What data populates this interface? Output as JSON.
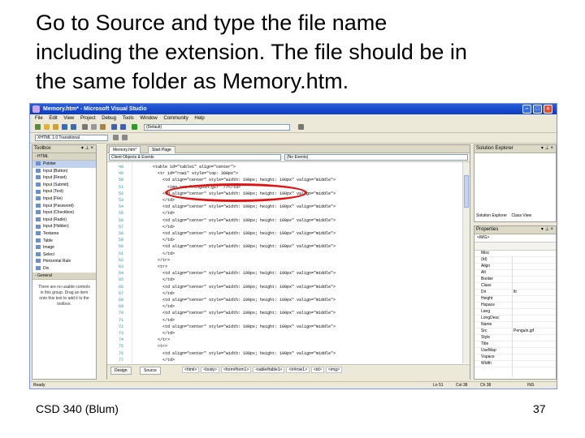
{
  "slide": {
    "title": "Go to Source and type the file name\nincluding the extension. The file should be in\nthe same folder as Memory.htm.",
    "footer_left": "CSD 340 (Blum)",
    "page_number": "37"
  },
  "window": {
    "title": "Memory.htm* - Microsoft Visual Studio",
    "menu": [
      "File",
      "Edit",
      "View",
      "Project",
      "Debug",
      "Tools",
      "Window",
      "Community",
      "Help"
    ],
    "toolbar_combo": "(Default)",
    "toolbar2_combo": "XHTML 1.0 Transitional"
  },
  "toolbox": {
    "title": "Toolbox",
    "section_html": "- HTML",
    "items": [
      "Pointer",
      "Input (Button)",
      "Input (Reset)",
      "Input (Submit)",
      "Input (Text)",
      "Input (File)",
      "Input (Password)",
      "Input (Checkbox)",
      "Input (Radio)",
      "Input (Hidden)",
      "Textarea",
      "Table",
      "Image",
      "Select",
      "Horizontal Rule",
      "Div"
    ],
    "section_general": "- General",
    "general_message": "There are no usable controls in this group. Drag an item onto this text to add it to the toolbox."
  },
  "editor": {
    "tabs": [
      "Memory.htm*",
      "Start Page"
    ],
    "left_combo": "Client Objects & Events",
    "right_combo": "(No Events)",
    "line_numbers": [
      "48",
      "49",
      "50",
      "51",
      "52",
      "53",
      "54",
      "55",
      "56",
      "57",
      "58",
      "59",
      "60",
      "61",
      "62",
      "63",
      "64",
      "65",
      "66",
      "67",
      "68",
      "69",
      "70",
      "71",
      "72",
      "73",
      "74",
      "75",
      "76",
      "77"
    ],
    "lines": [
      "        <table id=\"table1\" align=\"center\">",
      "          <tr id=\"row1\" style=\"top: 300px\">",
      "            <td align=\"center\" style=\"width: 100px; height: 100px\" valign=\"middle\">",
      "              <img src=\"Penguin.gif\" /></td>",
      "            <td align=\"center\" style=\"width: 100px; height: 100px\" valign=\"middle\">",
      "            </td>",
      "            <td align=\"center\" style=\"width: 100px; height: 100px\" valign=\"middle\">",
      "            </td>",
      "            <td align=\"center\" style=\"width: 100px; height: 100px\" valign=\"middle\">",
      "            </td>",
      "            <td align=\"center\" style=\"width: 100px; height: 100px\" valign=\"middle\">",
      "            </td>",
      "            <td align=\"center\" style=\"width: 100px; height: 100px\" valign=\"middle\">",
      "            </td>",
      "          </tr>",
      "          <tr>",
      "            <td align=\"center\" style=\"width: 100px; height: 100px\" valign=\"middle\">",
      "            </td>",
      "            <td align=\"center\" style=\"width: 100px; height: 100px\" valign=\"middle\">",
      "            </td>",
      "            <td align=\"center\" style=\"width: 100px; height: 100px\" valign=\"middle\">",
      "            </td>",
      "            <td align=\"center\" style=\"width: 100px; height: 100px\" valign=\"middle\">",
      "            </td>",
      "            <td align=\"center\" style=\"width: 100px; height: 100px\" valign=\"middle\">",
      "            </td>",
      "          </tr>",
      "          <tr>",
      "            <td align=\"center\" style=\"width: 100px; height: 100px\" valign=\"middle\">",
      "            </td>"
    ],
    "view_buttons": [
      "Design",
      "Source"
    ],
    "tag_nav": [
      "<html>",
      "<body>",
      "<form#form1>",
      "<table#table1>",
      "<tr#row1>",
      "<td>",
      "<img>"
    ]
  },
  "solution_explorer": {
    "title": "Solution Explorer",
    "tabs": [
      "Solution Explorer",
      "Class View"
    ]
  },
  "properties": {
    "title": "Properties",
    "object": "<IMG>",
    "rows": [
      {
        "name": "Misc",
        "value": ""
      },
      {
        "name": "(Id)",
        "value": ""
      },
      {
        "name": "Align",
        "value": ""
      },
      {
        "name": "Alt",
        "value": ""
      },
      {
        "name": "Border",
        "value": ""
      },
      {
        "name": "Class",
        "value": ""
      },
      {
        "name": "Dir",
        "value": "ltr"
      },
      {
        "name": "Height",
        "value": ""
      },
      {
        "name": "Hspace",
        "value": ""
      },
      {
        "name": "Lang",
        "value": ""
      },
      {
        "name": "LongDesc",
        "value": ""
      },
      {
        "name": "Name",
        "value": ""
      },
      {
        "name": "Src",
        "value": "Penguin.gif"
      },
      {
        "name": "Style",
        "value": ""
      },
      {
        "name": "Title",
        "value": ""
      },
      {
        "name": "UseMap",
        "value": ""
      },
      {
        "name": "Vspace",
        "value": ""
      },
      {
        "name": "Width",
        "value": ""
      }
    ]
  },
  "statusbar": {
    "left": "Ready",
    "ln": "Ln 51",
    "col": "Col 38",
    "ch": "Ch 38",
    "mode": "INS"
  }
}
